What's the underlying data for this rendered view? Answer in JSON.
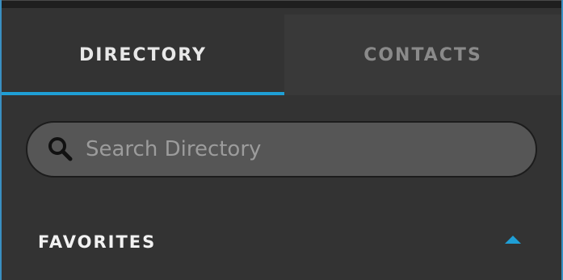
{
  "tabs": {
    "directory_label": "DIRECTORY",
    "contacts_label": "CONTACTS",
    "active": "DIRECTORY"
  },
  "search": {
    "placeholder": "Search Directory",
    "value": ""
  },
  "favorites": {
    "title": "FAVORITES",
    "expanded": true
  },
  "colors": {
    "accent": "#1f9fd6",
    "background": "#333333",
    "inactive_tab": "#393939",
    "search_field": "#565656"
  },
  "icons": {
    "search": "search-icon",
    "collapse": "caret-up-icon"
  }
}
